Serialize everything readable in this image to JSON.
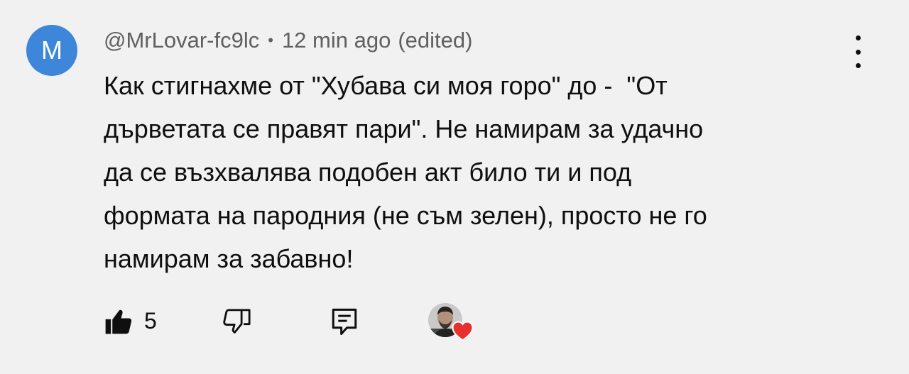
{
  "comment": {
    "avatar_letter": "M",
    "avatar_color": "#3e86d9",
    "author": "@MrLovar-fc9lc",
    "separator": "•",
    "time": "12 min ago",
    "edited_label": "(edited)",
    "text": "Как стигнахме от \"Хубава си моя горо\" до -  \"От\nдърветата се правят пари\". Не намирам за удачно\nда се възхвалява подобен акт било ти и под\nформата на пародния (не съм зелен), просто не го\nнамирам за забавно!",
    "likes": "5",
    "heart_color": "#e8312f"
  },
  "icons": {
    "menu": "more-vertical-icon",
    "like": "thumbs-up-filled-icon",
    "dislike": "thumbs-down-outline-icon",
    "reply": "comment-reply-icon",
    "creator_heart": "heart-icon"
  }
}
